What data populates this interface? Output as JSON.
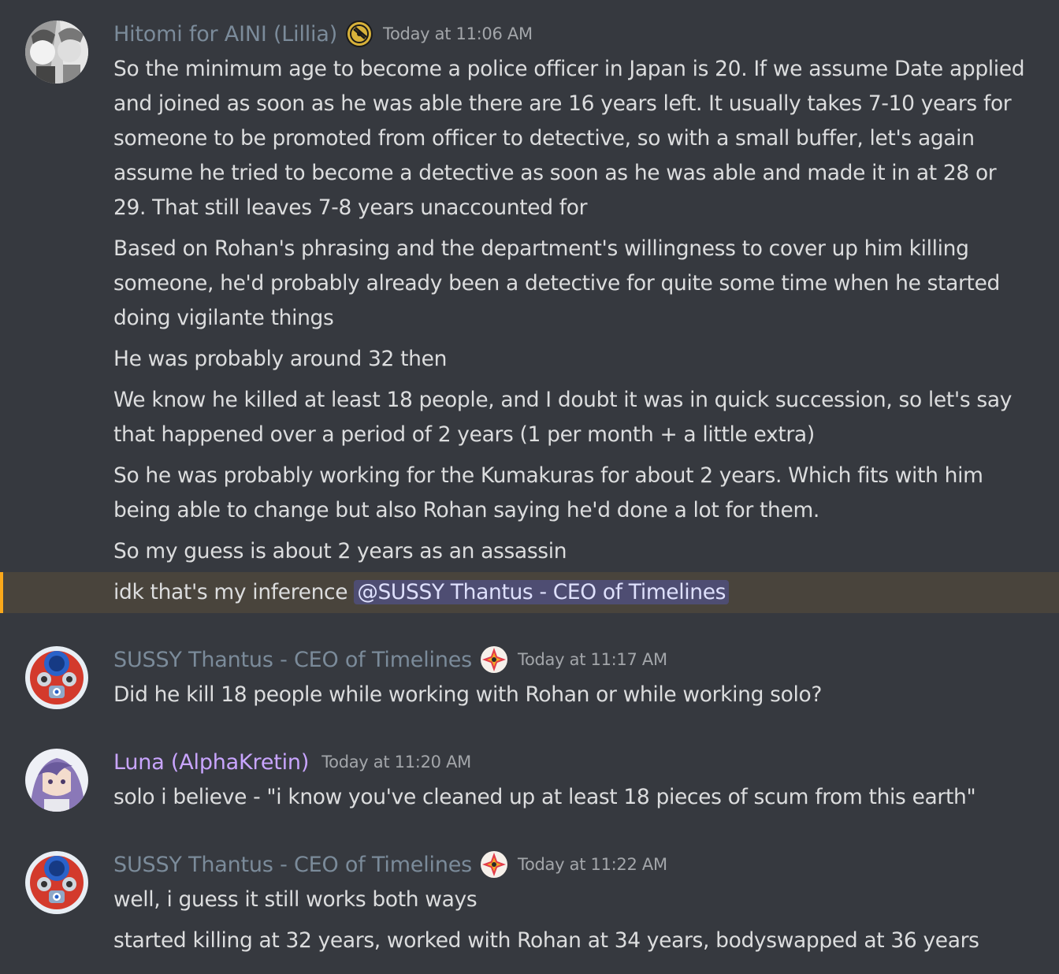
{
  "colors": {
    "background": "#36393f",
    "text": "#dcddde",
    "timestamp": "#a3a6aa",
    "hitomi_name": "#7b8b9a",
    "sussy_name": "#7b8b9a",
    "luna_name": "#c9a5ff",
    "mention_highlight": "#49443c",
    "mention_bar": "#faa81a",
    "mention_pill": "#5865f2"
  },
  "messages": [
    {
      "author": "Hitomi for AINI (Lillia)",
      "badge_icon": "gold-coin-badge-icon",
      "timestamp": "Today at 11:06 AM",
      "lines": [
        "So the minimum age to become a police officer in Japan is 20. If we assume Date applied and joined as soon as he was able there are 16 years left. It usually takes 7-10 years for someone to be promoted from officer to detective, so with a small buffer, let's again assume he tried to become a detective as soon as he was able and made it in at 28 or 29. That still leaves 7-8 years unaccounted for",
        "Based on Rohan's phrasing and the department's willingness to cover up him killing someone, he'd probably already been a detective for quite some time when he started doing vigilante things",
        "He was probably around 32 then",
        "We know he killed at least 18 people, and I doubt it was in quick succession, so let's say that happened over a period of 2 years (1 per month + a little extra)",
        "So he was probably working for the Kumakuras for about 2 years. Which fits with him being able to change but also Rohan saying he'd done a lot for them.",
        "So my guess is about 2 years as an assassin"
      ],
      "mention_line": {
        "text": "idk that's my inference ",
        "mention": "@SUSSY Thantus - CEO of Timelines"
      }
    },
    {
      "author": "SUSSY Thantus - CEO of Timelines",
      "badge_icon": "star-gem-badge-icon",
      "timestamp": "Today at 11:17 AM",
      "lines": [
        "Did he kill 18 people while working with Rohan or while working solo?"
      ]
    },
    {
      "author": "Luna (AlphaKretin)",
      "timestamp": "Today at 11:20 AM",
      "lines": [
        "solo i believe - \"i know you've cleaned up at least 18 pieces of scum from this earth\""
      ]
    },
    {
      "author": "SUSSY Thantus - CEO of Timelines",
      "badge_icon": "star-gem-badge-icon",
      "timestamp": "Today at 11:22 AM",
      "lines": [
        "well, i guess it still works both ways",
        "started killing at 32 years, worked with Rohan at 34 years, bodyswapped at 36 years"
      ]
    }
  ]
}
